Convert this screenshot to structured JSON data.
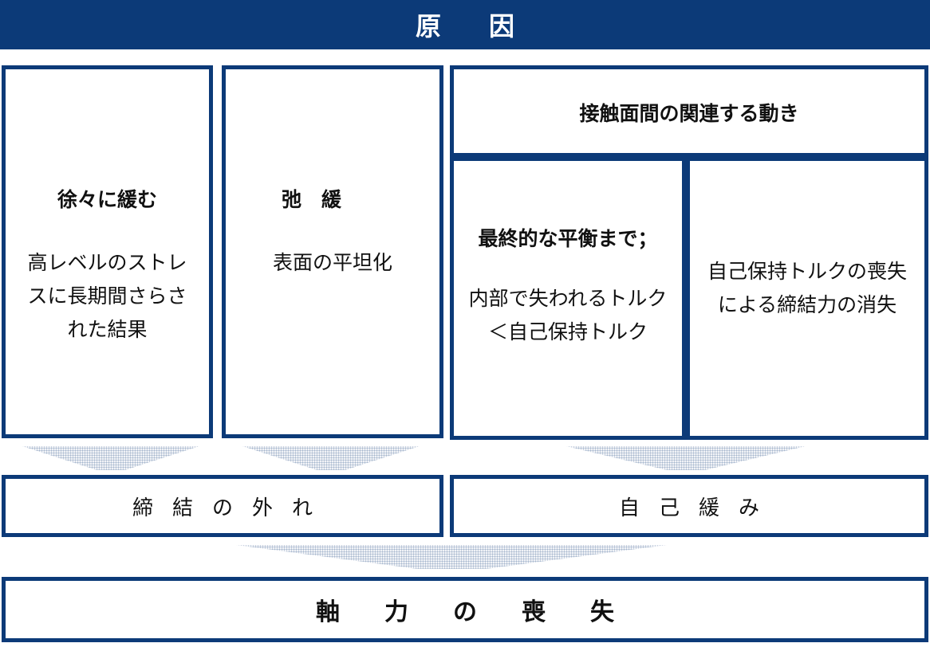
{
  "header": {
    "title": "原因"
  },
  "causes": {
    "gradual_loosening": {
      "title": "徐々に緩む",
      "body": "高レベルのスト​レ\nスに長期間さらさ\nれた結果"
    },
    "relaxation": {
      "title": "弛　緩",
      "body": "表面の平坦化"
    },
    "contact_motion": {
      "title": "接触面間の関連する動き"
    },
    "final_equilibrium": {
      "title": "最終的な平衡まで；",
      "body": "内部で失われるトルク\n＜自己保持トルク"
    },
    "self_holding_loss": {
      "body": "自己保持トルクの喪失\nによる締結力の消失"
    }
  },
  "effects": {
    "unfastening": "締結の外れ",
    "self_loosening": "自己緩み"
  },
  "result": {
    "title": "軸力の喪失"
  },
  "colors": {
    "primary": "#0c3a78",
    "background": "#ffffff",
    "text": "#111111"
  }
}
